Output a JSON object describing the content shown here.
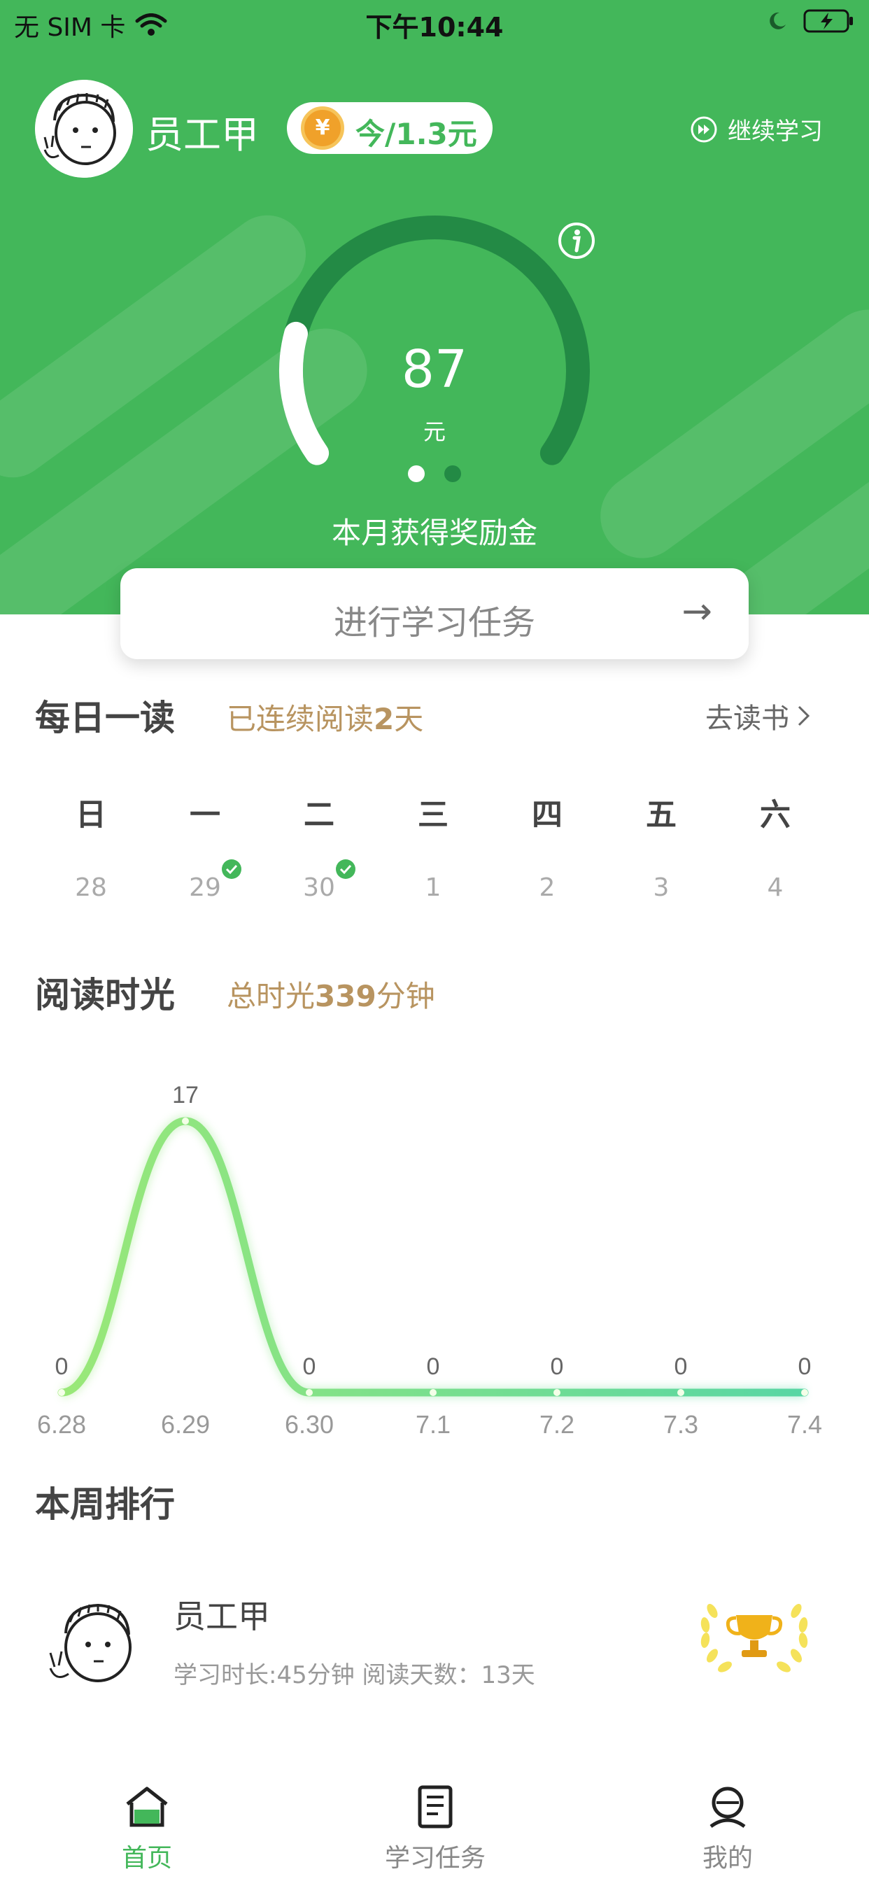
{
  "status_bar": {
    "carrier": "无 SIM 卡",
    "time": "下午10:44"
  },
  "header": {
    "username": "员工甲",
    "coin_text": "今/1.3元",
    "coin_symbol": "¥",
    "continue_label": "继续学习",
    "accent_color": "#43b75a",
    "dark_color": "#238a45"
  },
  "gauge": {
    "value": "87",
    "unit": "元",
    "label": "本月获得奖励金",
    "fill_fraction": 0.2,
    "page_dots": 2,
    "active_dot": 0
  },
  "task_card": {
    "label": "进行学习任务",
    "arrow": "→"
  },
  "daily_read": {
    "title": "每日一读",
    "subtitle_prefix": "已连续阅读",
    "subtitle_count": "2",
    "subtitle_suffix": "天",
    "go_read": "去读书",
    "weekdays": [
      "日",
      "一",
      "二",
      "三",
      "四",
      "五",
      "六"
    ],
    "dates": [
      "28",
      "29",
      "30",
      "1",
      "2",
      "3",
      "4"
    ],
    "checked": [
      false,
      true,
      true,
      false,
      false,
      false,
      false
    ]
  },
  "reading_time": {
    "title": "阅读时光",
    "subtitle_prefix": "总时光",
    "subtitle_value": "339",
    "subtitle_suffix": "分钟"
  },
  "chart_data": {
    "type": "line",
    "categories": [
      "6.28",
      "6.29",
      "6.30",
      "7.1",
      "7.2",
      "7.3",
      "7.4"
    ],
    "values": [
      0,
      17,
      0,
      0,
      0,
      0,
      0
    ],
    "data_labels": [
      "0",
      "17",
      "0",
      "0",
      "0",
      "0",
      "0"
    ],
    "ylim": [
      0,
      17
    ],
    "grid": false,
    "line_color_start": "#9ae878",
    "line_color_end": "#58d6a4"
  },
  "ranking": {
    "title": "本周排行",
    "name": "员工甲",
    "info": "学习时长:45分钟 阅读天数：13天"
  },
  "tabbar": {
    "items": [
      {
        "label": "首页",
        "icon": "home-icon",
        "active": true
      },
      {
        "label": "学习任务",
        "icon": "book-icon",
        "active": false
      },
      {
        "label": "我的",
        "icon": "user-icon",
        "active": false
      }
    ],
    "active_color": "#43b75a",
    "inactive_color": "#888888"
  }
}
